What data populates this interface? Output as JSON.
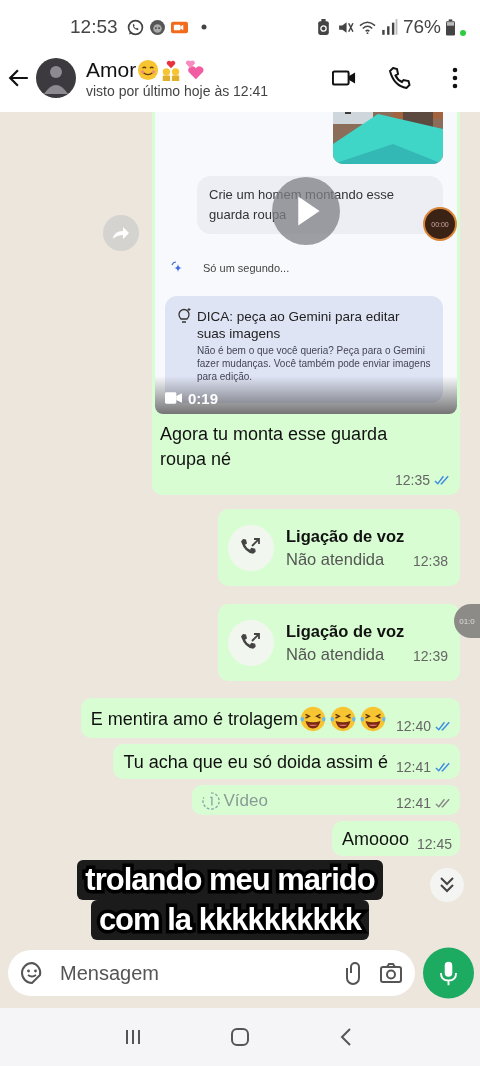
{
  "status_bar": {
    "time": "12:53",
    "battery": "76%"
  },
  "header": {
    "name": "Amor",
    "last_seen": "visto por último hoje às 12:41"
  },
  "messages": [
    {
      "kind": "video",
      "duration": "0:19",
      "caption": "Agora tu monta esse guarda roupa né",
      "time": "12:35",
      "read": true,
      "frame": {
        "prompt": "Crie um homem montando esse guarda roupa",
        "timer": "00:00",
        "status": "Só um segundo...",
        "tip_title": "DICA: peça ao Gemini para editar suas imagens",
        "tip_body": "Não é bem o que você queria? Peça para o Gemini fazer mudanças. Você também pode enviar imagens para edição."
      }
    },
    {
      "kind": "call",
      "title": "Ligação de voz",
      "subtitle": "Não atendida",
      "time": "12:38"
    },
    {
      "kind": "call",
      "title": "Ligação de voz",
      "subtitle": "Não atendida",
      "time": "12:39",
      "badge": "01:0"
    },
    {
      "kind": "text_laughing",
      "text": "E mentira amo é trolagem",
      "time": "12:40",
      "read": true
    },
    {
      "kind": "text",
      "text": "Tu acha que eu só doida assim é",
      "time": "12:41",
      "read": true
    },
    {
      "kind": "media",
      "label": "Vídeo",
      "time": "12:41",
      "read": false
    },
    {
      "kind": "text",
      "text": "Amoooo",
      "time": "12:45"
    }
  ],
  "caption_overlay": [
    "trolando meu marido",
    "com la kkkkkkkkkk"
  ],
  "composer": {
    "placeholder": "Mensagem"
  }
}
